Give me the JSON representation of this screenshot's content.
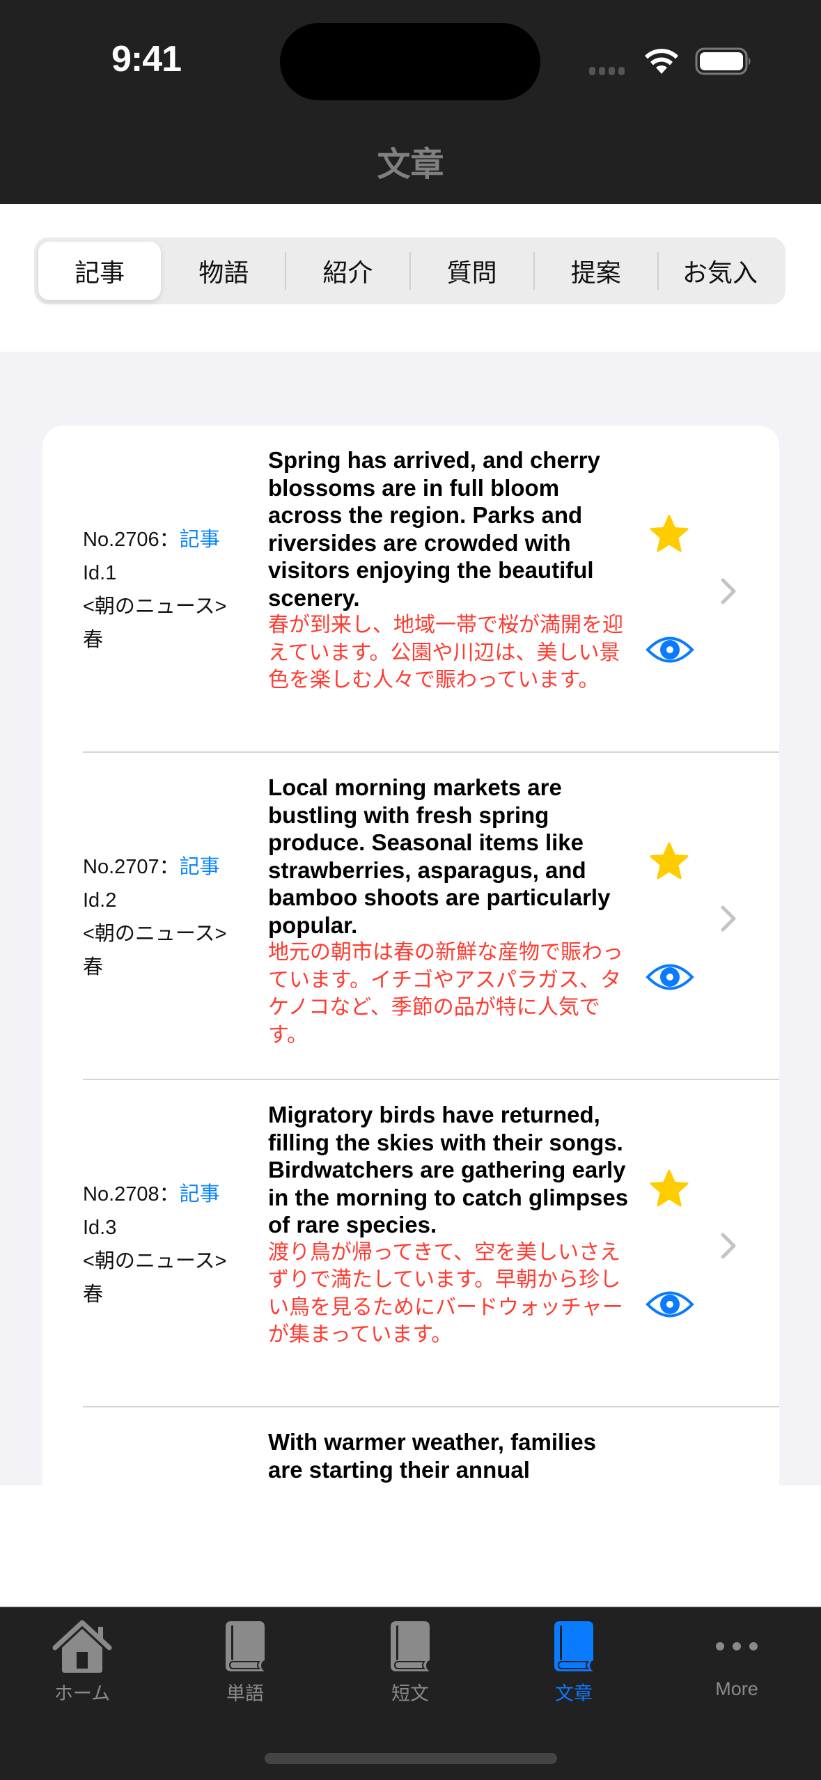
{
  "status_bar": {
    "time": "9:41"
  },
  "header": {
    "title": "文章"
  },
  "segments": {
    "selected_index": 0,
    "items": [
      "記事",
      "物語",
      "紹介",
      "質問",
      "提案",
      "お気入"
    ]
  },
  "articles": [
    {
      "number": "No.2706：",
      "category": "記事",
      "id": "Id.1",
      "source": "<朝のニュース>",
      "season": "春",
      "english": "Spring has arrived, and cherry blossoms are in full bloom across the region. Parks and riversides are crowded with visitors enjoying the beautiful scenery.",
      "japanese": "春が到来し、地域一帯で桜が満開を迎えています。公園や川辺は、美しい景色を楽しむ人々で賑わっています。",
      "favorite_icon": "star-filled-icon",
      "view_icon": "eye-icon"
    },
    {
      "number": "No.2707：",
      "category": "記事",
      "id": "Id.2",
      "source": "<朝のニュース>",
      "season": "春",
      "english": "Local morning markets are bustling with fresh spring produce. Seasonal items like strawberries, asparagus, and bamboo shoots are particularly popular.",
      "japanese": "地元の朝市は春の新鮮な産物で賑わっています。イチゴやアスパラガス、タケノコなど、季節の品が特に人気です。",
      "favorite_icon": "star-filled-icon",
      "view_icon": "eye-icon"
    },
    {
      "number": "No.2708：",
      "category": "記事",
      "id": "Id.3",
      "source": "<朝のニュース>",
      "season": "春",
      "english": "Migratory birds have returned, filling the skies with their songs. Birdwatchers are gathering early in the morning to catch glimpses of rare species.",
      "japanese": "渡り鳥が帰ってきて、空を美しいさえずりで満たしています。早朝から珍しい鳥を見るためにバードウォッチャーが集まっています。",
      "favorite_icon": "star-filled-icon",
      "view_icon": "eye-icon"
    },
    {
      "english_partial": "With warmer weather, families are starting their annual"
    }
  ],
  "tab_bar": {
    "active_index": 3,
    "items": [
      {
        "label": "ホーム",
        "icon": "house-icon"
      },
      {
        "label": "単語",
        "icon": "book-icon"
      },
      {
        "label": "短文",
        "icon": "book-icon"
      },
      {
        "label": "文章",
        "icon": "book-icon"
      },
      {
        "label": "More",
        "icon": "ellipsis-icon"
      }
    ]
  },
  "colors": {
    "accent": "#0A84FF",
    "japanese_text": "#FF3B30",
    "star": "#FFCC00",
    "bar_background": "#212121",
    "list_background": "#F2F2F7"
  }
}
